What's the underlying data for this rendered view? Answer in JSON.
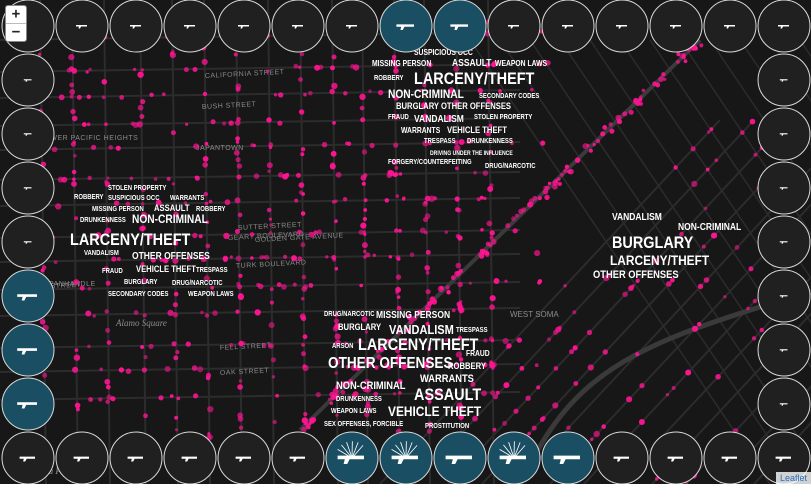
{
  "controls": {
    "zoom_in": "+",
    "zoom_out": "−"
  },
  "attribution": "Leaflet",
  "colors": {
    "incident": "#ff1493",
    "disk_dark": "#202020",
    "disk_light": "#1a4e63",
    "ring": "#d9d9d9",
    "street": "#2c2c2c"
  },
  "street_labels": [
    "CALIFORNIA STREET",
    "BUSH STREET",
    "JAPANTOWN",
    "SUTTER STREET",
    "GEARY BOULEVARD",
    "GOLDEN GATE AVENUE",
    "TURK BOULEVARD",
    "FULTON STREET",
    "FELL STREET",
    "OAK STREET",
    "WEST SOMA",
    "NORTH OF PANHANDLE",
    "LOWER PACIFIC HEIGHTS"
  ],
  "place_labels": [
    "Alamo Square",
    "Buena Vista Park"
  ],
  "clusters": [
    {
      "id": "north",
      "words": [
        {
          "t": "SUSPICIOUS OCC",
          "s": 8
        },
        {
          "t": "MISSING PERSON",
          "s": 8
        },
        {
          "t": "ASSAULT",
          "s": 10
        },
        {
          "t": "WEAPON LAWS",
          "s": 8
        },
        {
          "t": "ROBBERY",
          "s": 7
        },
        {
          "t": "LARCENY/THEFT",
          "s": 17
        },
        {
          "t": "NON-CRIMINAL",
          "s": 12
        },
        {
          "t": "SECONDARY CODES",
          "s": 7
        },
        {
          "t": "BURGLARY",
          "s": 9
        },
        {
          "t": "OTHER OFFENSES",
          "s": 9
        },
        {
          "t": "FRAUD",
          "s": 7
        },
        {
          "t": "VANDALISM",
          "s": 10
        },
        {
          "t": "STOLEN PROPERTY",
          "s": 7
        },
        {
          "t": "WARRANTS",
          "s": 8
        },
        {
          "t": "VEHICLE THEFT",
          "s": 9
        },
        {
          "t": "TRESPASS",
          "s": 7
        },
        {
          "t": "DRUNKENNESS",
          "s": 7
        },
        {
          "t": "DRIVING UNDER THE INFLUENCE",
          "s": 6
        },
        {
          "t": "FORGERY/COUNTERFEITING",
          "s": 7
        },
        {
          "t": "DRUG/NARCOTIC",
          "s": 7
        }
      ]
    },
    {
      "id": "west",
      "words": [
        {
          "t": "STOLEN PROPERTY",
          "s": 7
        },
        {
          "t": "ROBBERY",
          "s": 7
        },
        {
          "t": "SUSPICIOUS OCC",
          "s": 7
        },
        {
          "t": "WARRANTS",
          "s": 7
        },
        {
          "t": "MISSING PERSON",
          "s": 7
        },
        {
          "t": "ASSAULT",
          "s": 9
        },
        {
          "t": "ROBBERY",
          "s": 7
        },
        {
          "t": "DRUNKENNESS",
          "s": 7
        },
        {
          "t": "NON-CRIMINAL",
          "s": 12
        },
        {
          "t": "LARCENY/THEFT",
          "s": 17
        },
        {
          "t": "VANDALISM",
          "s": 7
        },
        {
          "t": "OTHER OFFENSES",
          "s": 10
        },
        {
          "t": "FRAUD",
          "s": 7
        },
        {
          "t": "VEHICLE THEFT",
          "s": 9
        },
        {
          "t": "TRESPASS",
          "s": 7
        },
        {
          "t": "BURGLARY",
          "s": 7
        },
        {
          "t": "DRUG/NARCOTIC",
          "s": 7
        },
        {
          "t": "SECONDARY CODES",
          "s": 7
        },
        {
          "t": "WEAPON LAWS",
          "s": 7
        }
      ]
    },
    {
      "id": "east",
      "words": [
        {
          "t": "VANDALISM",
          "s": 10
        },
        {
          "t": "NON-CRIMINAL",
          "s": 10
        },
        {
          "t": "BURGLARY",
          "s": 17
        },
        {
          "t": "LARCENY/THEFT",
          "s": 14
        },
        {
          "t": "OTHER OFFENSES",
          "s": 11
        }
      ]
    },
    {
      "id": "south",
      "words": [
        {
          "t": "DRUG/NARCOTIC",
          "s": 7
        },
        {
          "t": "MISSING PERSON",
          "s": 10
        },
        {
          "t": "BURGLARY",
          "s": 9
        },
        {
          "t": "VANDALISM",
          "s": 13
        },
        {
          "t": "TRESPASS",
          "s": 7
        },
        {
          "t": "ARSON",
          "s": 7
        },
        {
          "t": "LARCENY/THEFT",
          "s": 17
        },
        {
          "t": "OTHER OFFENSES",
          "s": 16
        },
        {
          "t": "FRAUD",
          "s": 8
        },
        {
          "t": "ROBBERY",
          "s": 9
        },
        {
          "t": "WARRANTS",
          "s": 11
        },
        {
          "t": "NON-CRIMINAL",
          "s": 11
        },
        {
          "t": "ASSAULT",
          "s": 17
        },
        {
          "t": "DRUNKENNESS",
          "s": 7
        },
        {
          "t": "WEAPON LAWS",
          "s": 7
        },
        {
          "t": "VEHICLE THEFT",
          "s": 14
        },
        {
          "t": "SEX OFFENSES, FORCIBLE",
          "s": 7
        },
        {
          "t": "PROSTITUTION",
          "s": 7
        }
      ]
    }
  ],
  "border_disks": {
    "top_light": [
      7,
      8
    ],
    "left_light": [
      4,
      5,
      6,
      7
    ],
    "bottom_light": [
      6,
      7,
      8,
      9,
      10
    ],
    "right_light": []
  }
}
